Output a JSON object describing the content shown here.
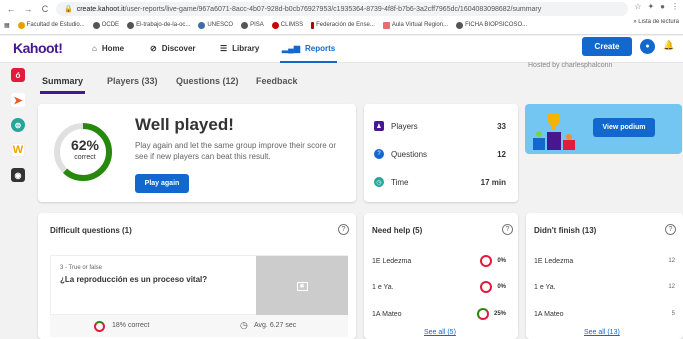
{
  "browser": {
    "url_host": "create.kahoot.it",
    "url_path": "/user-reports/live-game/967a6071-8acc-4b07-928d-b0cb76927953/c1935364-8739-4f8f-b7b6-3a2cff7965dc/1604083098682/summary",
    "bookmarks": [
      {
        "label": "Facultad de Estudio...",
        "color": "#e8a000"
      },
      {
        "label": "OCDE",
        "color": "#555555"
      },
      {
        "label": "El-trabajo-de-la-oc...",
        "color": "#555555"
      },
      {
        "label": "UNESCO",
        "color": "#3a6ea5"
      },
      {
        "label": "PISA",
        "color": "#555555"
      },
      {
        "label": "CLIMSS",
        "color": "#cc0000"
      },
      {
        "label": "Federación de Ense...",
        "color": "#b30000"
      },
      {
        "label": "Aula Virtual Region...",
        "color": "#e07070"
      },
      {
        "label": "FICHA BIOPSICOSO...",
        "color": "#555555"
      }
    ],
    "bookmarks_more": "»",
    "reading_list": "Lista de lectura"
  },
  "nav": {
    "logo": "Kahoot!",
    "home": "Home",
    "discover": "Discover",
    "library": "Library",
    "reports": "Reports",
    "create": "Create"
  },
  "tabs": {
    "summary": "Summary",
    "players": "Players (33)",
    "questions": "Questions (12)",
    "feedback": "Feedback",
    "hosted": "Hosted by charlesphalconn"
  },
  "summary": {
    "title": "Well played!",
    "description": "Play again and let the same group improve their score or see if new players can beat this result.",
    "play_again": "Play again",
    "percent": "62%",
    "percent_label": "correct",
    "percent_value": 0.62
  },
  "stats": {
    "players_label": "Players",
    "players_value": "33",
    "questions_label": "Questions",
    "questions_value": "12",
    "time_label": "Time",
    "time_value": "17 min"
  },
  "podium": {
    "button": "View podium"
  },
  "difficult": {
    "title": "Difficult questions (1)",
    "q_type": "3 - True or false",
    "q_text": "¿La reproducción es un proceso vital?",
    "correct": "18% correct",
    "avg": "Avg. 6.27 sec"
  },
  "need_help": {
    "title": "Need help (5)",
    "rows": [
      {
        "name": "1E Ledezma",
        "value": "0%"
      },
      {
        "name": "1 e Ya.",
        "value": "0%"
      },
      {
        "name": "1A Mateo",
        "value": "25%"
      }
    ],
    "see_all": "See all (5)"
  },
  "didnt_finish": {
    "title": "Didn't finish (13)",
    "rows": [
      {
        "name": "1E Ledezma",
        "value": "12"
      },
      {
        "name": "1 e Ya.",
        "value": "12"
      },
      {
        "name": "1A Mateo",
        "value": "5"
      }
    ],
    "see_all": "See all (13)"
  },
  "colors": {
    "accent": "#1368ce",
    "brand": "#46178f",
    "correct": "#26890c",
    "wrong": "#e21b3c"
  }
}
